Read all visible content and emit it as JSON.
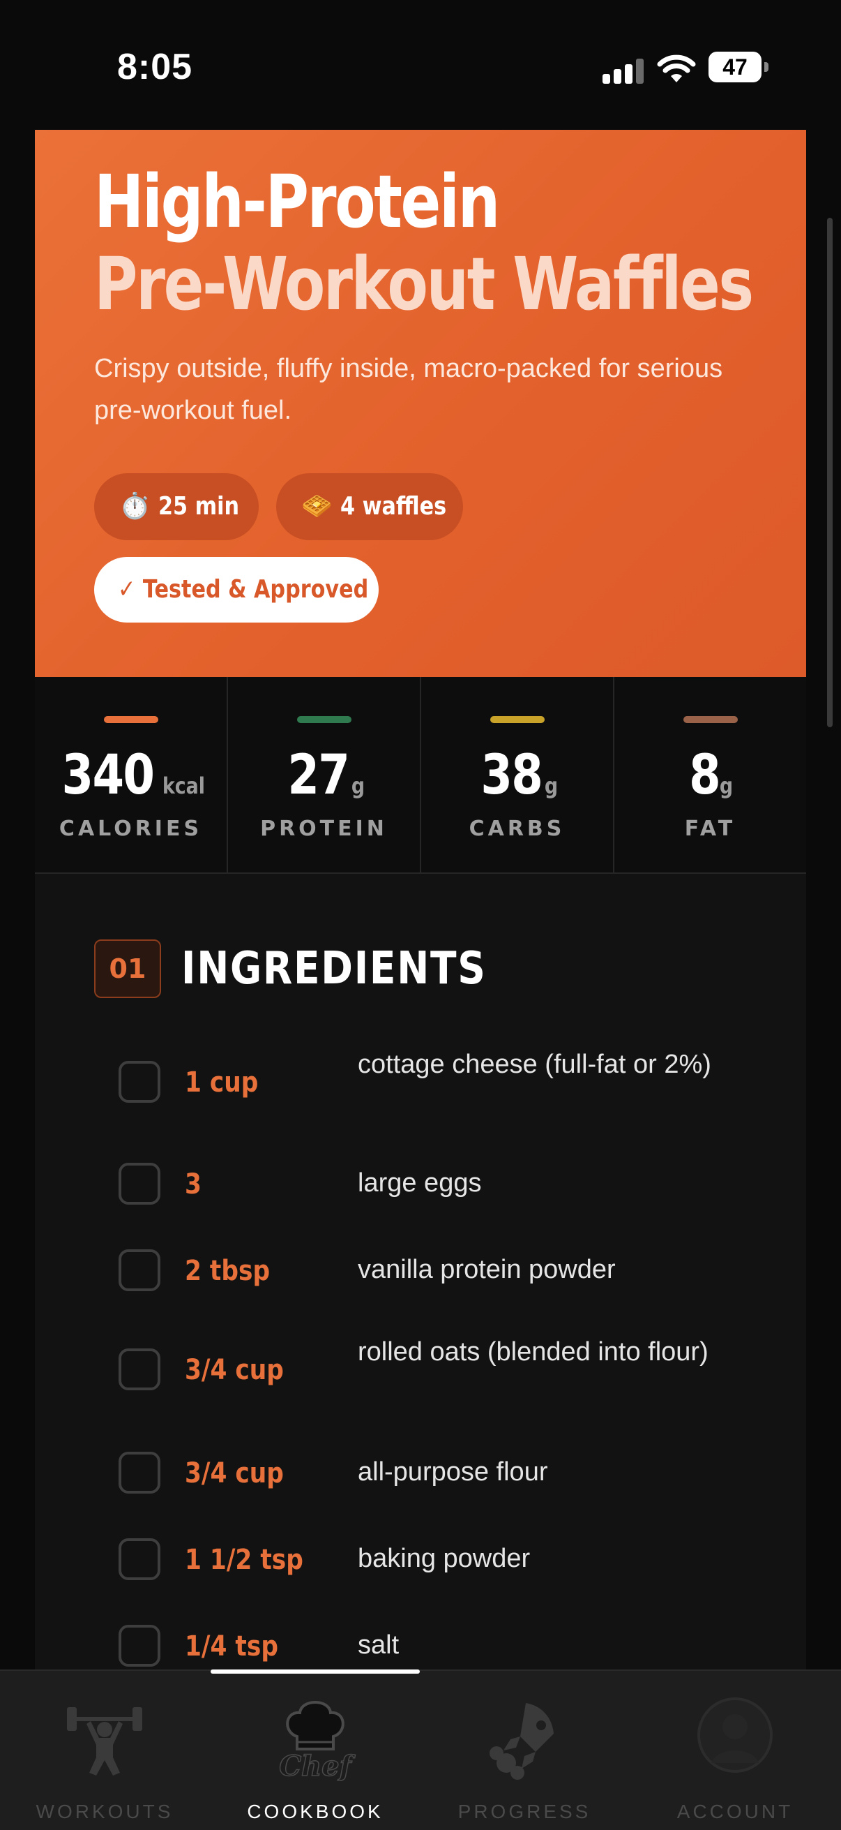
{
  "status_bar": {
    "time": "8:05",
    "battery": "47"
  },
  "recipe": {
    "title_line1": "High-Protein",
    "title_line2": "Pre-Workout Waffles",
    "description": "Crispy outside, fluffy inside, macro-packed for serious pre-workout fuel.",
    "time_icon": "⏱️",
    "time": "25 min",
    "yield_icon": "🧇",
    "yield": "4 waffles",
    "badge": "✓ Tested & Approved"
  },
  "macros": [
    {
      "value": "340",
      "unit": "kcal",
      "label": "CALORIES",
      "color": "#e8703a"
    },
    {
      "value": "27",
      "unit": "g",
      "label": "PROTEIN",
      "color": "#2f7a4f"
    },
    {
      "value": "38",
      "unit": "g",
      "label": "CARBS",
      "color": "#c9a22a"
    },
    {
      "value": "8",
      "unit": "g",
      "label": "FAT",
      "color": "#9a6249"
    }
  ],
  "ingredients_section": {
    "number": "01",
    "title": "INGREDIENTS"
  },
  "ingredients": [
    {
      "qty": "1 cup",
      "name": "cottage cheese (full-fat or 2%)"
    },
    {
      "qty": "3",
      "name": "large eggs"
    },
    {
      "qty": "2 tbsp",
      "name": "vanilla protein powder"
    },
    {
      "qty": "3/4 cup",
      "name": "rolled oats (blended into flour)"
    },
    {
      "qty": "3/4 cup",
      "name": "all-purpose flour"
    },
    {
      "qty": "1 1/2 tsp",
      "name": "baking powder"
    },
    {
      "qty": "1/4 tsp",
      "name": "salt"
    }
  ],
  "tabs": [
    {
      "label": "WORKOUTS",
      "icon": "weightlifter-icon",
      "active": false
    },
    {
      "label": "COOKBOOK",
      "icon": "chef-hat-icon",
      "active": true,
      "icon_text": "Chef"
    },
    {
      "label": "PROGRESS",
      "icon": "rocket-icon",
      "active": false
    },
    {
      "label": "ACCOUNT",
      "icon": "account-icon",
      "active": false
    }
  ]
}
